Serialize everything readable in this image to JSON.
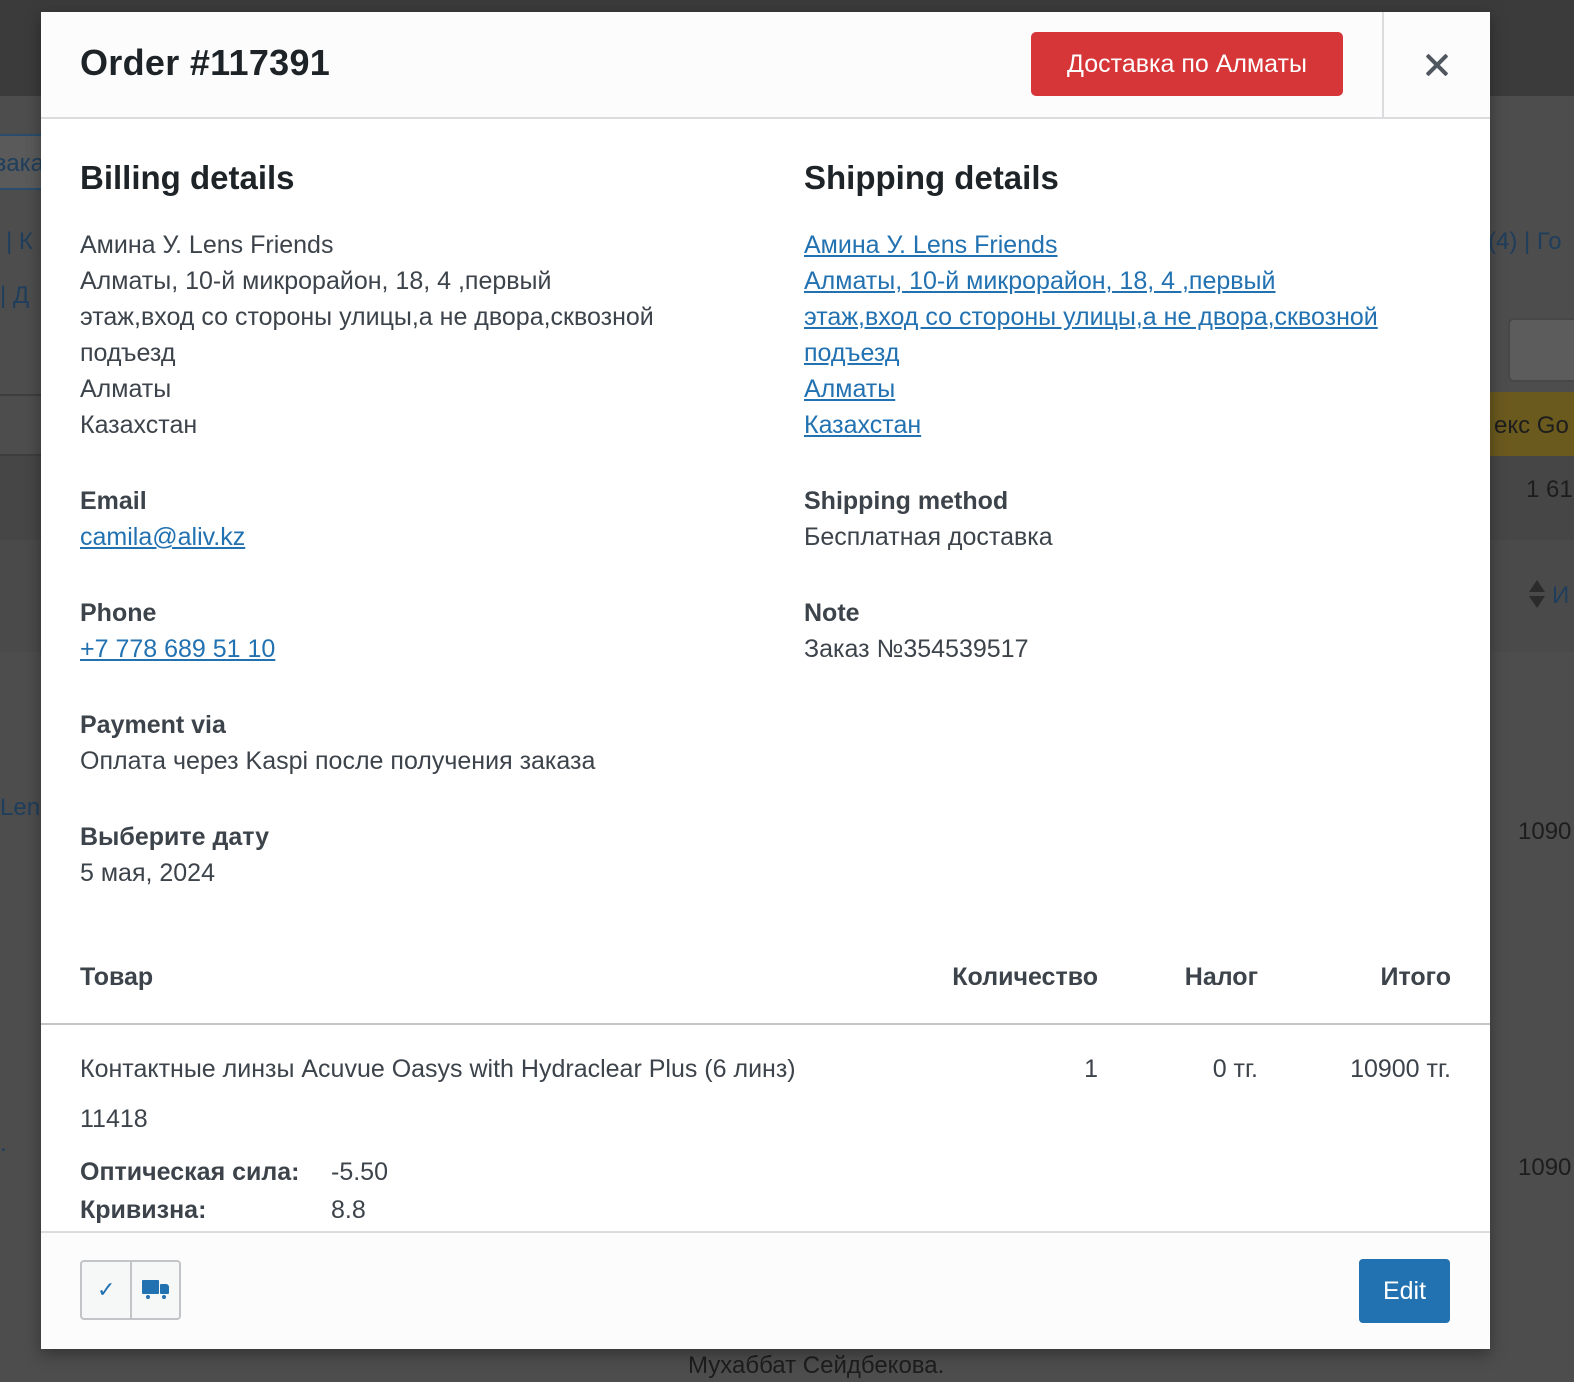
{
  "background": {
    "fragments": [
      "зака",
      "| К",
      "| Д",
      "(4) | Го",
      "екс Go",
      "1 61",
      "И",
      "Lens",
      "1090",
      ".",
      "1090",
      "Мухаббат Сейдбекова."
    ]
  },
  "modal": {
    "title": "Order #117391",
    "status_badge": "Доставка по Алматы",
    "status_color": "#d63638",
    "close_icon": "close-icon"
  },
  "billing": {
    "heading": "Billing details",
    "address": [
      "Амина У. Lens Friends",
      "Алматы, 10-й микрорайон, 18, 4 ,первый",
      "этаж,вход со стороны улицы,а не двора,сквозной",
      "подъезд",
      "Алматы",
      "Казахстан"
    ],
    "email_label": "Email",
    "email": "camila@aliv.kz",
    "phone_label": "Phone",
    "phone": "+7 778 689 51 10",
    "payment_label": "Payment via",
    "payment": "Оплата через Kaspi после получения заказа",
    "date_label": "Выберите дату",
    "date": "5 мая, 2024"
  },
  "shipping": {
    "heading": "Shipping details",
    "address": [
      "Амина У. Lens Friends",
      "Алматы, 10-й микрорайон, 18, 4 ,первый",
      "этаж,вход со стороны улицы,а не двора,сквозной",
      "подъезд",
      "Алматы",
      "Казахстан"
    ],
    "method_label": "Shipping method",
    "method": "Бесплатная доставка",
    "note_label": "Note",
    "note": "Заказ №354539517"
  },
  "items": {
    "columns": [
      "Товар",
      "Количество",
      "Налог",
      "Итого"
    ],
    "rows": [
      {
        "name": "Контактные линзы Acuvue Oasys with Hydraclear Plus (6 линз)",
        "sku": "11418",
        "quantity": "1",
        "tax": "0 тг.",
        "total": "10900 тг.",
        "meta": [
          {
            "key": "Оптическая сила:",
            "value": "-5.50"
          },
          {
            "key": "Кривизна:",
            "value": "8.8"
          }
        ]
      }
    ]
  },
  "footer": {
    "actions": [
      {
        "icon": "check-icon",
        "glyph": "✓"
      },
      {
        "icon": "truck-icon"
      }
    ],
    "edit_label": "Edit",
    "accent": "#2271b1"
  }
}
